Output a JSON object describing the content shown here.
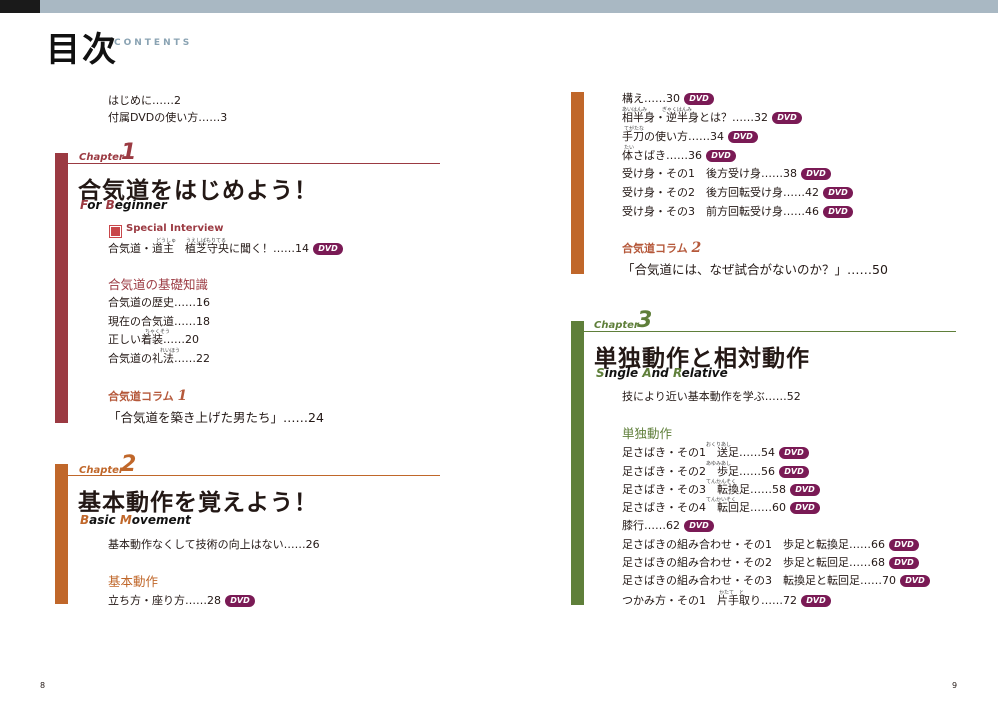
{
  "header": {
    "title": "目次",
    "subtitle": "CONTENTS"
  },
  "intro": [
    "はじめに……2",
    "付属DVDの使い方……3"
  ],
  "dvd_badge": "DVD",
  "chapter1": {
    "label": "Chapter",
    "num": "1",
    "title": "合気道をはじめよう！",
    "en_1": "F",
    "en_2": "or ",
    "en_3": "B",
    "en_4": "eginner",
    "special_label": "Special Interview",
    "special_line": "合気道・道主　植芝守央に聞く！……14",
    "special_ruby_1": "どうしゅ",
    "special_ruby_2": "うえしばもりてる",
    "section": "合気道の基礎知識",
    "items": [
      "合気道の歴史……16",
      "現在の合気道……18",
      "正しい着装……20",
      "合気道の礼法……22"
    ],
    "ruby_chakusou": "ちゃくそう",
    "ruby_reihou": "れいほう",
    "column_label": "合気道コラム",
    "column_num": "1",
    "column_title": "「合気道を築き上げた男たち」……24"
  },
  "chapter2": {
    "label": "Chapter",
    "num": "2",
    "title": "基本動作を覚えよう！",
    "en_1": "B",
    "en_2": "asic ",
    "en_3": "M",
    "en_4": "ovement",
    "intro": "基本動作なくして技術の向上はない……26",
    "section": "基本動作",
    "items": [
      "立ち方・座り方……28"
    ]
  },
  "right_top": {
    "items": [
      "構え……30",
      "相半身・逆半身とは？……32",
      "手刀の使い方……34",
      "体さばき……36",
      "受け身・その1　後方受け身……38",
      "受け身・その2　後方回転受け身……42",
      "受け身・その3　前方回転受け身……46"
    ],
    "ruby_ai": "あいはんみ",
    "ruby_gyaku": "ぎゃくはんみ",
    "ruby_shutou": "てがたな",
    "ruby_tai": "たい",
    "column_label": "合気道コラム",
    "column_num": "2",
    "column_title": "「合気道には、なぜ試合がないのか？」……50"
  },
  "chapter3": {
    "label": "Chapter",
    "num": "3",
    "title": "単独動作と相対動作",
    "en_1": "S",
    "en_2": "ingle ",
    "en_3": "A",
    "en_4": "nd ",
    "en_5": "R",
    "en_6": "elative",
    "intro": "技により近い基本動作を学ぶ……52",
    "section": "単独動作",
    "items": [
      "足さばき・その1　送足……54",
      "足さばき・その2　歩足……56",
      "足さばき・その3　転換足……58",
      "足さばき・その4　転回足……60",
      "膝行……62",
      "足さばきの組み合わせ・その1　歩足と転換足……66",
      "足さばきの組み合わせ・その2　歩足と転回足……68",
      "足さばきの組み合わせ・その3　転換足と転回足……70",
      "つかみ方・その1　片手取り……72"
    ],
    "ruby_okuri": "おくりあし",
    "ruby_ayumi": "あゆみあし",
    "ruby_tenkan": "てんかんそく",
    "ruby_tenkai": "てんかいそく",
    "ruby_kata": "かたて　と"
  },
  "page_numbers": {
    "left": "8",
    "right": "9"
  },
  "colors": {
    "ch1": "#9b3a42",
    "ch2": "#c0672a",
    "ch3": "#5f7f3a",
    "column": "#b5583a",
    "dvd": "#7a1a55"
  }
}
